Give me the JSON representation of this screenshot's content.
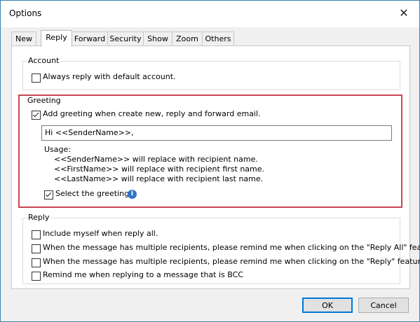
{
  "window": {
    "title": "Options"
  },
  "tabs": [
    "New",
    "Reply",
    "Forward",
    "Security",
    "Show",
    "Zoom",
    "Others"
  ],
  "active_tab": "Reply",
  "account": {
    "legend": "Account",
    "always_default": {
      "label": "Always reply with default account.",
      "checked": false
    }
  },
  "greeting": {
    "legend": "Greeting",
    "add_greeting": {
      "label": "Add greeting when create new, reply and forward email.",
      "checked": true
    },
    "template_value": "Hi <<SenderName>>,",
    "usage_title": "Usage:",
    "usage_lines": [
      "<<SenderName>> will replace with recipient name.",
      "<<FirstName>> will replace with recipient first name.",
      "<<LastName>> will replace with recipient last name."
    ],
    "select_greeting": {
      "label": "Select the greeting.",
      "checked": true
    },
    "info_glyph": "i"
  },
  "reply": {
    "legend": "Reply",
    "options": [
      {
        "label": "Include myself when reply all.",
        "checked": false
      },
      {
        "label": "When the message has multiple recipients, please remind me when clicking on the \"Reply All\" feature.",
        "checked": false
      },
      {
        "label": "When the message has multiple recipients, please remind me when clicking on the \"Reply\" feature.",
        "checked": false
      },
      {
        "label": "Remind me when replying to a message that is BCC",
        "checked": false
      }
    ]
  },
  "buttons": {
    "ok": "OK",
    "cancel": "Cancel"
  },
  "colors": {
    "highlight": "#c9474f",
    "accent": "#0078d7",
    "info": "#2f75c9"
  },
  "icons": {
    "close": "close-icon",
    "info": "info-icon",
    "check": "checkmark-icon"
  }
}
